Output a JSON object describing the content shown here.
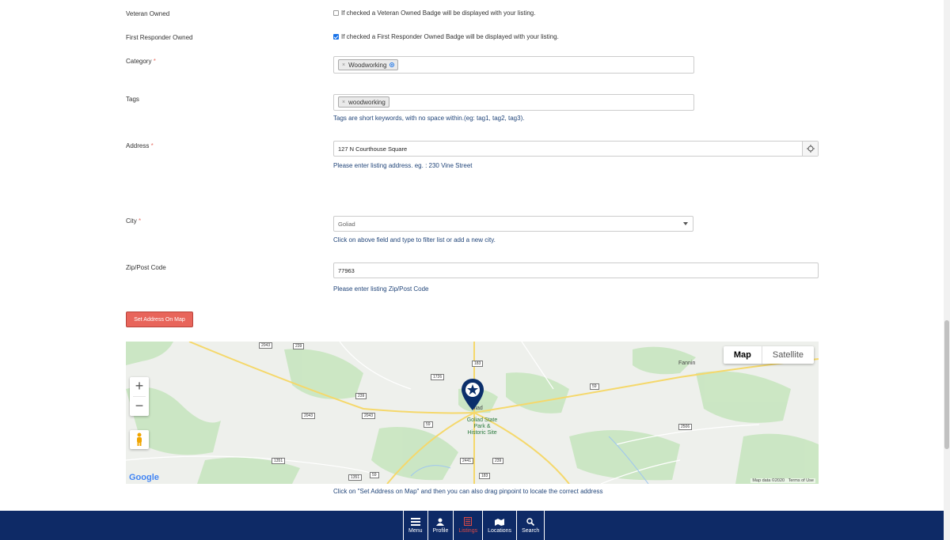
{
  "form": {
    "veteran": {
      "label": "Veteran Owned",
      "text": "If checked a Veteran Owned Badge will be displayed with your listing.",
      "checked": false
    },
    "responder": {
      "label": "First Responder Owned",
      "text": "If checked a First Responder Owned Badge will be displayed with your listing.",
      "checked": true
    },
    "category": {
      "label": "Category",
      "required": "*",
      "chip": "Woodworking"
    },
    "tags": {
      "label": "Tags",
      "chip": "woodworking",
      "help": "Tags are short keywords, with no space within.(eg: tag1, tag2, tag3)."
    },
    "address": {
      "label": "Address",
      "required": "*",
      "value": "127 N Courthouse Square",
      "help": "Please enter listing address. eg. : 230 Vine Street"
    },
    "city": {
      "label": "City",
      "required": "*",
      "value": "Goliad",
      "help": "Click on above field and type to filter list or add a new city."
    },
    "zip": {
      "label": "Zip/Post Code",
      "value": "77963",
      "help": "Please enter listing Zip/Post Code"
    },
    "set_map_button": "Set Address On Map",
    "map_help": "Click on \"Set Address on Map\" and then you can also drag pinpoint to locate the correct address"
  },
  "map": {
    "type_map": "Map",
    "type_satellite": "Satellite",
    "zoom_in": "+",
    "zoom_out": "−",
    "google": "Google",
    "map_data": "Map data ©2020",
    "terms": "Terms of Use",
    "town": "Fannin",
    "city_label": "oliad",
    "park": [
      "Goliad State",
      "Park &",
      "Historic Site"
    ],
    "roads": [
      "2043",
      "239",
      "183",
      "1726",
      "59",
      "239",
      "2043",
      "2043",
      "59",
      "2506",
      "1351",
      "1351",
      "59",
      "2441",
      "239",
      "183"
    ]
  },
  "nav": {
    "items": [
      {
        "label": "Menu",
        "icon": "menu-icon"
      },
      {
        "label": "Profile",
        "icon": "user-icon"
      },
      {
        "label": "Listings",
        "icon": "listings-icon"
      },
      {
        "label": "Locations",
        "icon": "map-icon"
      },
      {
        "label": "Search",
        "icon": "search-icon"
      }
    ],
    "active": "Listings"
  }
}
